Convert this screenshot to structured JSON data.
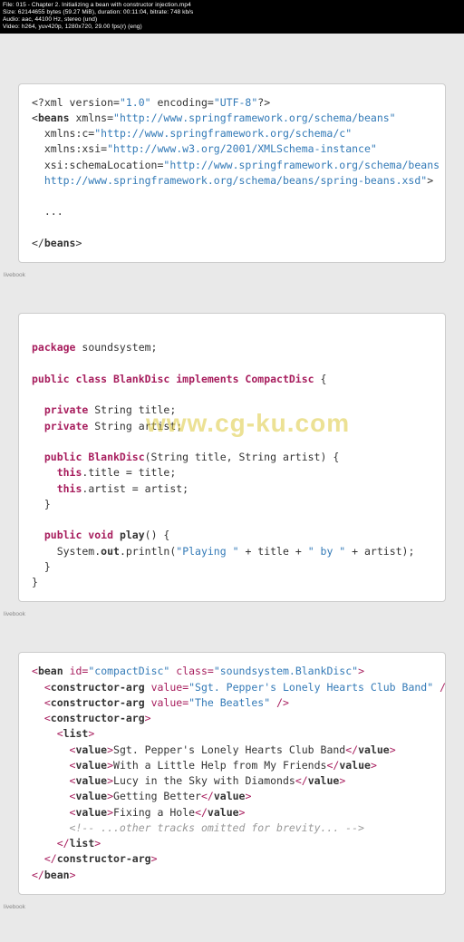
{
  "meta": {
    "l1": "File: 015 - Chapter 2. Initializing a bean with constructor injection.mp4",
    "l2": "Size: 62144655 bytes (59.27 MiB), duration: 00:11:04, bitrate: 748 kb/s",
    "l3": "Audio: aac, 44100 Hz, stereo (und)",
    "l4": "Video: h264, yuv420p, 1280x720, 29.00 fps(r) (eng)"
  },
  "watermark": "www.cg-ku.com",
  "badges": {
    "a": "livebook",
    "b": "livebook",
    "c": "livebook"
  },
  "xml1": {
    "decl_pre": "<?xml version=",
    "decl_ver": "\"1.0\"",
    "decl_mid": " encoding=",
    "decl_enc": "\"UTF-8\"",
    "decl_end": "?>",
    "l2a": "<",
    "l2b": "beans",
    "l2c": " xmlns=",
    "l2d": "\"http://www.springframework.org/schema/beans\"",
    "l3a": "  xmlns:c=",
    "l3b": "\"http://www.springframework.org/schema/c\"",
    "l4a": "  xmlns:xsi=",
    "l4b": "\"http://www.w3.org/2001/XMLSchema-instance\"",
    "l5a": "  xsi:schemaLocation=",
    "l5b": "\"http://www.springframework.org/schema/beans",
    "l6": "  http://www.springframework.org/schema/beans/spring-beans.xsd\"",
    "l6end": ">",
    "dots": "  ...",
    "close": "</",
    "closeb": "beans",
    "closec": ">"
  },
  "java": {
    "l1a": "package",
    "l1b": " soundsystem;",
    "l3a": "public class ",
    "l3b": "BlankDisc",
    "l3c": " implements ",
    "l3d": "CompactDisc",
    "l3e": " {",
    "l5a": "  private",
    "l5b": " String title;",
    "l6a": "  private",
    "l6b": " String artist;",
    "l8a": "  public ",
    "l8b": "BlankDisc",
    "l8c": "(String title, String artist) {",
    "l9a": "    this",
    "l9b": ".title = title;",
    "l10a": "    this",
    "l10b": ".artist = artist;",
    "l11": "  }",
    "l13a": "  public void ",
    "l13b": "play",
    "l13c": "() {",
    "l14a": "    System.",
    "l14b": "out",
    "l14c": ".println(",
    "l14d": "\"Playing \"",
    "l14e": " + title + ",
    "l14f": "\" by \"",
    "l14g": " + artist);",
    "l15": "  }",
    "l16": "}"
  },
  "xml2": {
    "l1": "<bean id=\"compactDisc\" class=\"soundsystem.BlankDisc\">",
    "l2": "  <constructor-arg value=\"Sgt. Pepper's Lonely Hearts Club Band\" />",
    "l3": "  <constructor-arg value=\"The Beatles\" />",
    "l4": "  <constructor-arg>",
    "l5": "    <list>",
    "l6": "      <value>Sgt. Pepper's Lonely Hearts Club Band</value>",
    "l7": "      <value>With a Little Help from My Friends</value>",
    "l8": "      <value>Lucy in the Sky with Diamonds</value>",
    "l9": "      <value>Getting Better</value>",
    "l10": "      <value>Fixing a Hole</value>",
    "l11": "      <!-- ...other tracks omitted for brevity... -->",
    "l12": "    </list>",
    "l13": "  </constructor-arg>",
    "l14": "</bean>"
  }
}
